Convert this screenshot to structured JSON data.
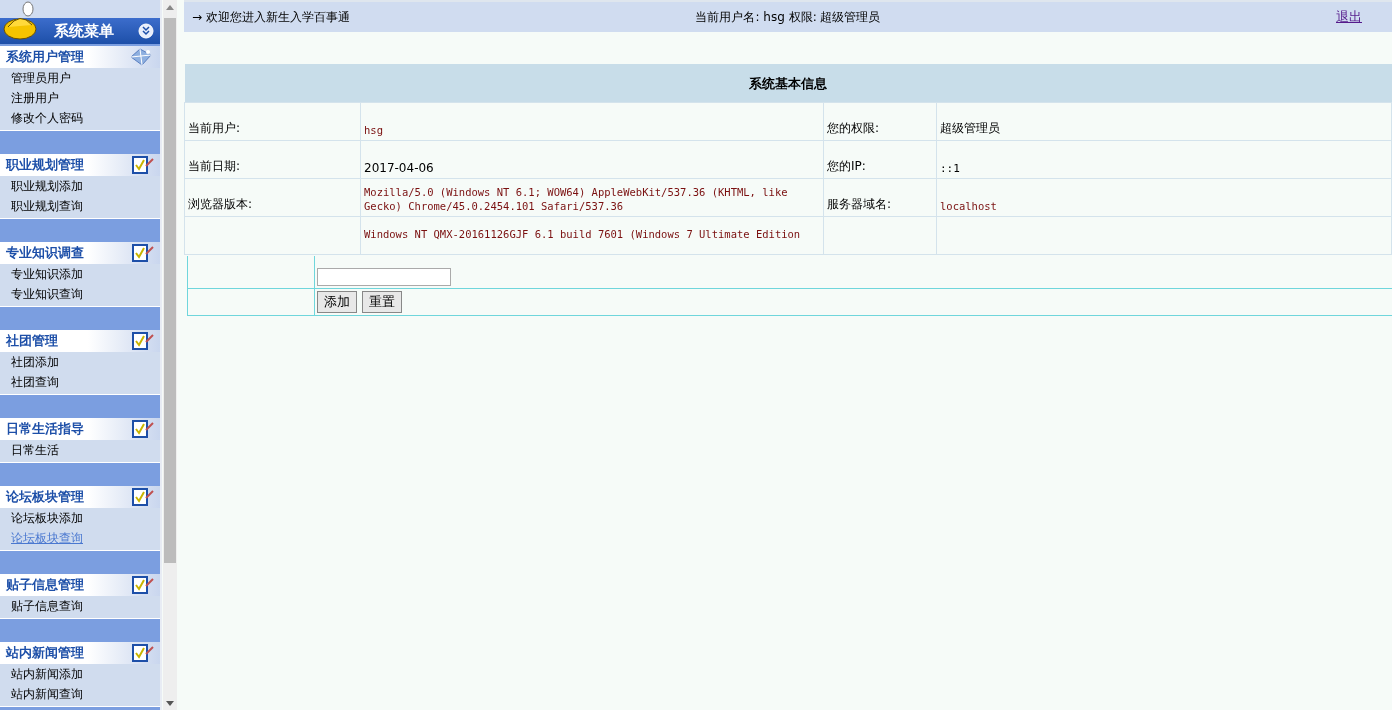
{
  "sidebar": {
    "title": "系统菜单",
    "sections": [
      {
        "title": "系统用户管理",
        "kind": "gem",
        "items": [
          {
            "label": "管理员用户",
            "hovered": false
          },
          {
            "label": "注册用户",
            "hovered": false
          },
          {
            "label": "修改个人密码",
            "hovered": false
          }
        ]
      },
      {
        "title": "职业规划管理",
        "kind": "checklist",
        "items": [
          {
            "label": "职业规划添加",
            "hovered": false
          },
          {
            "label": "职业规划查询",
            "hovered": false
          }
        ]
      },
      {
        "title": "专业知识调查",
        "kind": "checklist",
        "items": [
          {
            "label": "专业知识添加",
            "hovered": false
          },
          {
            "label": "专业知识查询",
            "hovered": false
          }
        ]
      },
      {
        "title": "社团管理",
        "kind": "checklist",
        "items": [
          {
            "label": "社团添加",
            "hovered": false
          },
          {
            "label": "社团查询",
            "hovered": false
          }
        ]
      },
      {
        "title": "日常生活指导",
        "kind": "checklist",
        "items": [
          {
            "label": "日常生活",
            "hovered": false
          }
        ]
      },
      {
        "title": "论坛板块管理",
        "kind": "checklist",
        "items": [
          {
            "label": "论坛板块添加",
            "hovered": false
          },
          {
            "label": "论坛板块查询",
            "hovered": true
          }
        ]
      },
      {
        "title": "贴子信息管理",
        "kind": "checklist",
        "items": [
          {
            "label": "贴子信息查询",
            "hovered": false
          }
        ]
      },
      {
        "title": "站内新闻管理",
        "kind": "checklist",
        "items": [
          {
            "label": "站内新闻添加",
            "hovered": false
          },
          {
            "label": "站内新闻查询",
            "hovered": false
          }
        ]
      }
    ]
  },
  "top_bar": {
    "welcome": "→ 欢迎您进入新生入学百事通",
    "user_info": "当前用户名: hsg 权限: 超级管理员",
    "logout": "退出"
  },
  "info_table": {
    "title": "系统基本信息",
    "rows": [
      {
        "label_1": "当前用户:",
        "value_1": {
          "text": "hsg",
          "kind": "code"
        },
        "label_2": "您的权限:",
        "value_2": {
          "text": "超级管理员",
          "kind": "plain"
        }
      },
      {
        "label_1": "当前日期:",
        "value_1": {
          "text": "2017-04-06",
          "kind": "plain"
        },
        "label_2": "您的IP:",
        "value_2": {
          "text": "::1",
          "kind": "mono"
        }
      },
      {
        "label_1": "浏览器版本:",
        "value_1": {
          "text": "Mozilla/5.0 (Windows NT 6.1; WOW64) AppleWebKit/537.36 (KHTML, like Gecko) Chrome/45.0.2454.101 Safari/537.36",
          "kind": "code"
        },
        "label_2": "服务器域名:",
        "value_2": {
          "text": "localhost",
          "kind": "code"
        }
      },
      {
        "value_1": {
          "text": "Windows NT QMX-20161126GJF 6.1 build 7601 (Windows 7 Ultimate Edition",
          "kind": "code"
        }
      }
    ]
  },
  "form": {
    "buttons": [
      "添加",
      "重置"
    ]
  }
}
